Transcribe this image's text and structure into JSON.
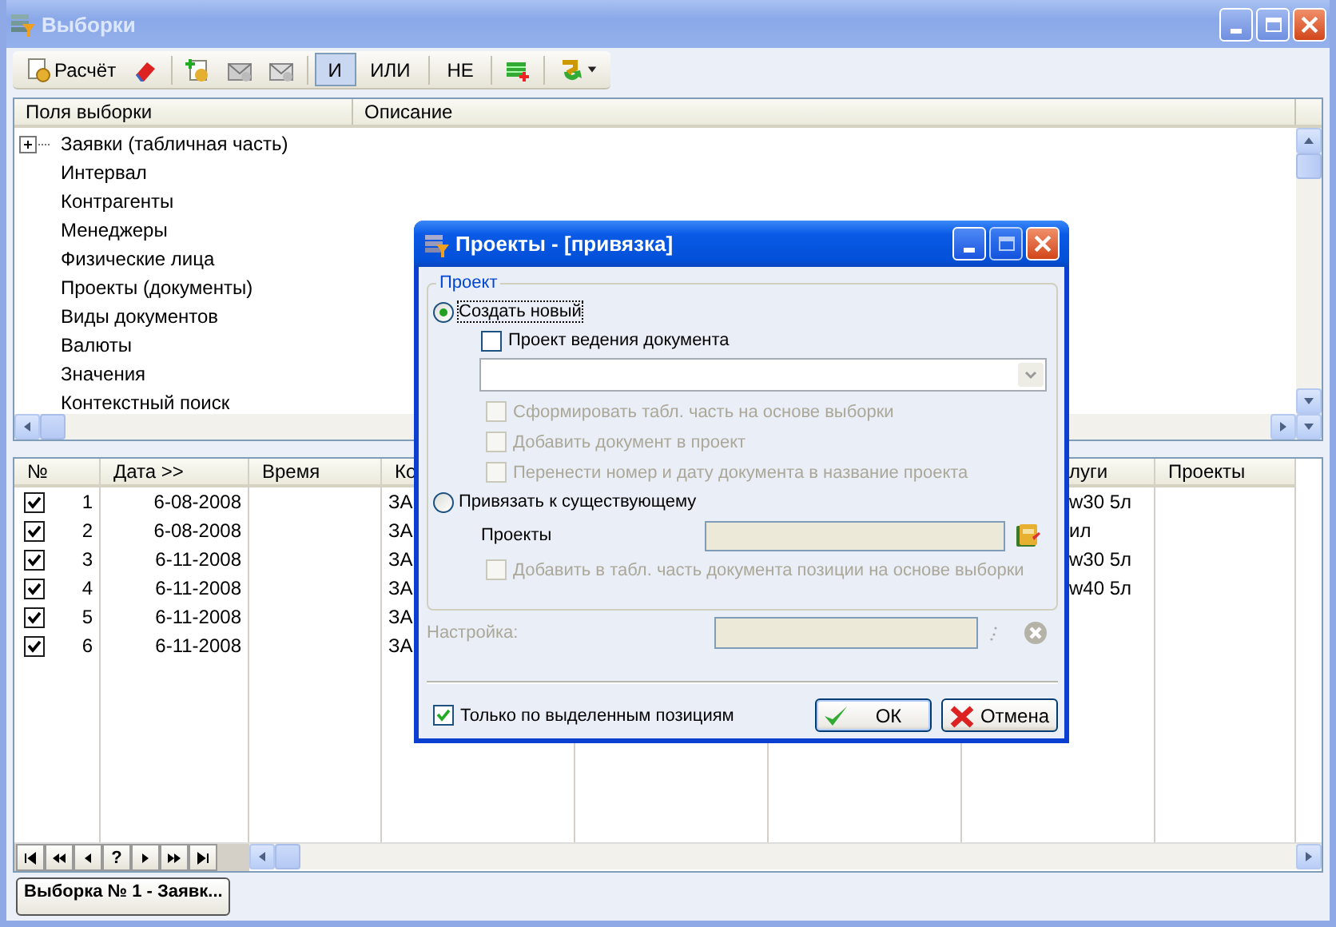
{
  "window": {
    "title": "Выборки"
  },
  "toolbar": [
    {
      "kind": "calc",
      "label": "Расчёт"
    },
    {
      "kind": "eraser"
    },
    {
      "kind": "separator"
    },
    {
      "kind": "add"
    },
    {
      "kind": "export"
    },
    {
      "kind": "import"
    },
    {
      "kind": "separator"
    },
    {
      "kind": "toggle",
      "label": "И",
      "selected": true
    },
    {
      "kind": "toggle",
      "label": "ИЛИ",
      "selected": false
    },
    {
      "kind": "separator"
    },
    {
      "kind": "toggle",
      "label": "НЕ",
      "selected": false
    },
    {
      "kind": "separator"
    },
    {
      "kind": "table-add"
    },
    {
      "kind": "separator"
    },
    {
      "kind": "refresh"
    }
  ],
  "tree": {
    "columns": [
      "Поля выборки",
      "Описание"
    ],
    "items": [
      {
        "kind": "group",
        "label": "Заявки (табличная часть)",
        "expanded": false
      },
      {
        "kind": "field",
        "label": "Интервал"
      },
      {
        "kind": "field",
        "label": "Контрагенты"
      },
      {
        "kind": "field",
        "label": "Менеджеры"
      },
      {
        "kind": "field",
        "label": "Физические лица"
      },
      {
        "kind": "field",
        "label": "Проекты (документы)"
      },
      {
        "kind": "field",
        "label": "Виды документов"
      },
      {
        "kind": "field",
        "label": "Валюты"
      },
      {
        "kind": "field",
        "label": "Значения"
      },
      {
        "kind": "field",
        "label": "Контекстный поиск"
      }
    ]
  },
  "grid": {
    "columns": [
      "№",
      "Дата >>",
      "Время",
      "Ко",
      "луги",
      "Проекты"
    ],
    "rows": [
      {
        "checked": true,
        "number": "1",
        "date": "6-08-2008",
        "column_4": "ЗА",
        "column_7": "w30 5л"
      },
      {
        "checked": true,
        "number": "2",
        "date": "6-08-2008",
        "column_4": "ЗА",
        "column_7": "ил"
      },
      {
        "checked": true,
        "number": "3",
        "date": "6-11-2008",
        "column_4": "ЗА",
        "column_7": "w30 5л"
      },
      {
        "checked": true,
        "number": "4",
        "date": "6-11-2008",
        "column_4": "ЗА",
        "column_7": "w40 5л"
      },
      {
        "checked": true,
        "number": "5",
        "date": "6-11-2008",
        "column_4": "ЗА"
      },
      {
        "checked": true,
        "number": "6",
        "date": "6-11-2008",
        "column_4": "ЗА"
      }
    ]
  },
  "navigator": {
    "help_label": "?"
  },
  "tabs": [
    {
      "label": "Выборка № 1 - Заявк...",
      "selected": true
    }
  ],
  "dialog": {
    "title": "Проекты - [привязка]",
    "group_title": "Проект",
    "modes": [
      {
        "label": "Создать новый",
        "selected": true
      },
      {
        "label": "Привязать к существующему",
        "selected": false
      }
    ],
    "doc_project": {
      "label": "Проект ведения документа",
      "checked": false
    },
    "create_options": [
      {
        "label": "Сформировать табл. часть на основе выборки",
        "checked": false,
        "disabled": true
      },
      {
        "label": "Добавить документ в проект",
        "checked": false,
        "disabled": true
      },
      {
        "label": "Перенести номер и дату документа в название проекта",
        "checked": false,
        "disabled": true
      }
    ],
    "projects_label": "Проекты",
    "link_option": {
      "label": "Добавить в табл. часть документа позиции на основе выборки",
      "checked": false,
      "disabled": true
    },
    "settings": {
      "label": "Настройка:",
      "disabled": true
    },
    "only_selected": {
      "label": "Только по выделенным позициям",
      "checked": true
    },
    "buttons": [
      {
        "kind": "ok",
        "label": "ОК"
      },
      {
        "kind": "cancel",
        "label": "Отмена"
      }
    ]
  }
}
